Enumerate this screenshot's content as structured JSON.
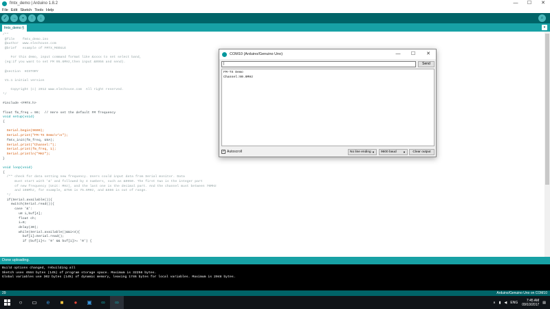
{
  "window": {
    "title": "fmtx_demo | Arduino 1.8.2",
    "controls": [
      "—",
      "☐",
      "✕"
    ]
  },
  "menu": [
    "File",
    "Edit",
    "Sketch",
    "Tools",
    "Help"
  ],
  "tab": {
    "name": "fmtx_demo §",
    "menu_glyph": "▾"
  },
  "code": [
    {
      "cls": "c-comment",
      "text": "/**"
    },
    {
      "cls": "c-comment",
      "text": " @file    fmtx_demo.ino"
    },
    {
      "cls": "c-comment",
      "text": " @author  www.elechouse.com"
    },
    {
      "cls": "c-comment",
      "text": " @brief   example of FMTX_MODULE"
    },
    {
      "cls": "c-comment",
      "text": ""
    },
    {
      "cls": "c-comment",
      "text": "    For this demo, input command format like &xxxx to set select band,"
    },
    {
      "cls": "c-comment",
      "text": " (eg:if you want to set FM 95.6MHz,then input &0956 and send)."
    },
    {
      "cls": "c-comment",
      "text": ""
    },
    {
      "cls": "c-comment",
      "text": " @section  HISTORY"
    },
    {
      "cls": "c-comment",
      "text": ""
    },
    {
      "cls": "c-comment",
      "text": " V1.1 initial version"
    },
    {
      "cls": "c-comment",
      "text": ""
    },
    {
      "cls": "c-comment",
      "text": "    Copyright (c) 2012 www.elechouse.com  All right reserved."
    },
    {
      "cls": "c-comment",
      "text": "*/"
    },
    {
      "cls": "c-plain",
      "text": ""
    },
    {
      "cls": "c-plain",
      "text": "#include <FMTX.h>"
    },
    {
      "cls": "c-plain",
      "text": ""
    },
    {
      "cls": "c-plain",
      "text": "float fm_freq = 90;  // Here set the default FM frequency"
    },
    {
      "cls": "c-kw",
      "text": "void setup(void)"
    },
    {
      "cls": "c-plain",
      "text": "{"
    },
    {
      "cls": "c-plain",
      "text": ""
    },
    {
      "cls": "c-func",
      "text": "  Serial.begin(9600);"
    },
    {
      "cls": "c-func",
      "text": "  Serial.print(\"FM-TX Demo\\r\\n\");"
    },
    {
      "cls": "c-plain",
      "text": "  fmtx_init(fm_freq, USA);"
    },
    {
      "cls": "c-func",
      "text": "  Serial.print(\"Channel:\");"
    },
    {
      "cls": "c-func",
      "text": "  Serial.print(fm_freq, 1);"
    },
    {
      "cls": "c-func",
      "text": "  Serial.println(\"MHz\");"
    },
    {
      "cls": "c-plain",
      "text": "}"
    },
    {
      "cls": "c-plain",
      "text": ""
    },
    {
      "cls": "c-kw",
      "text": "void loop(void)"
    },
    {
      "cls": "c-plain",
      "text": "{"
    },
    {
      "cls": "c-comment",
      "text": "  /** check for data setting new frequency. Users could input data from Serial monitor. Data"
    },
    {
      "cls": "c-comment",
      "text": "      must start with '&' and followed by 4 numbers, such as &0950. The first two is the integer part"
    },
    {
      "cls": "c-comment",
      "text": "      of new frequency (Unit: MHz), and the last one is the decimal part. And the channel must between 70MHz"
    },
    {
      "cls": "c-comment",
      "text": "      and 108Mhz, for example, &756 is 75.6MHz, and &666 is out of range."
    },
    {
      "cls": "c-comment",
      "text": "  */"
    },
    {
      "cls": "c-plain",
      "text": "  if(Serial.available()){"
    },
    {
      "cls": "c-plain",
      "text": "    switch(Serial.read()){"
    },
    {
      "cls": "c-plain",
      "text": "      case '&':"
    },
    {
      "cls": "c-plain",
      "text": "        u8 i,buf[4];"
    },
    {
      "cls": "c-plain",
      "text": "        float ch;"
    },
    {
      "cls": "c-plain",
      "text": "        i=0;"
    },
    {
      "cls": "c-plain",
      "text": "        delay(30);"
    },
    {
      "cls": "c-plain",
      "text": "        while(Serial.available()&&i<4){"
    },
    {
      "cls": "c-plain",
      "text": "          buf[i]=Serial.read();"
    },
    {
      "cls": "c-plain",
      "text": "          if (buf[i]<= '9' && buf[i]>= '0') {"
    }
  ],
  "console": {
    "status": "Done uploading.",
    "lines": [
      "Build options changed, rebuilding all",
      "Sketch uses 4584 bytes (14%) of program storage space. Maximum is 32256 bytes.",
      "Global variables use 302 bytes (14%) of dynamic memory, leaving 1746 bytes for local variables. Maximum is 2048 bytes."
    ],
    "line_number": "29",
    "board": "Arduino/Genuino Uno on COM10"
  },
  "serial_monitor": {
    "title": "COM10 (Arduino/Genuino Uno)",
    "input_value": "|",
    "send_label": "Send",
    "output": [
      "FM-TX Demo",
      "Channel:90.0MHz"
    ],
    "autoscroll_label": "Autoscroll",
    "autoscroll_checked": "✓",
    "line_ending": "No line ending",
    "baud": "9600 baud",
    "clear_label": "Clear output",
    "controls": [
      "—",
      "☐",
      "✕"
    ]
  },
  "taskbar": {
    "time": "7:45 AM",
    "date": "09/10/2017",
    "lang": "ENG",
    "apps": [
      "search-icon",
      "task-view-icon",
      "edge-icon",
      "file-explorer-icon",
      "chrome-icon",
      "store-icon",
      "arduino-icon",
      "arduino-active-icon"
    ]
  }
}
